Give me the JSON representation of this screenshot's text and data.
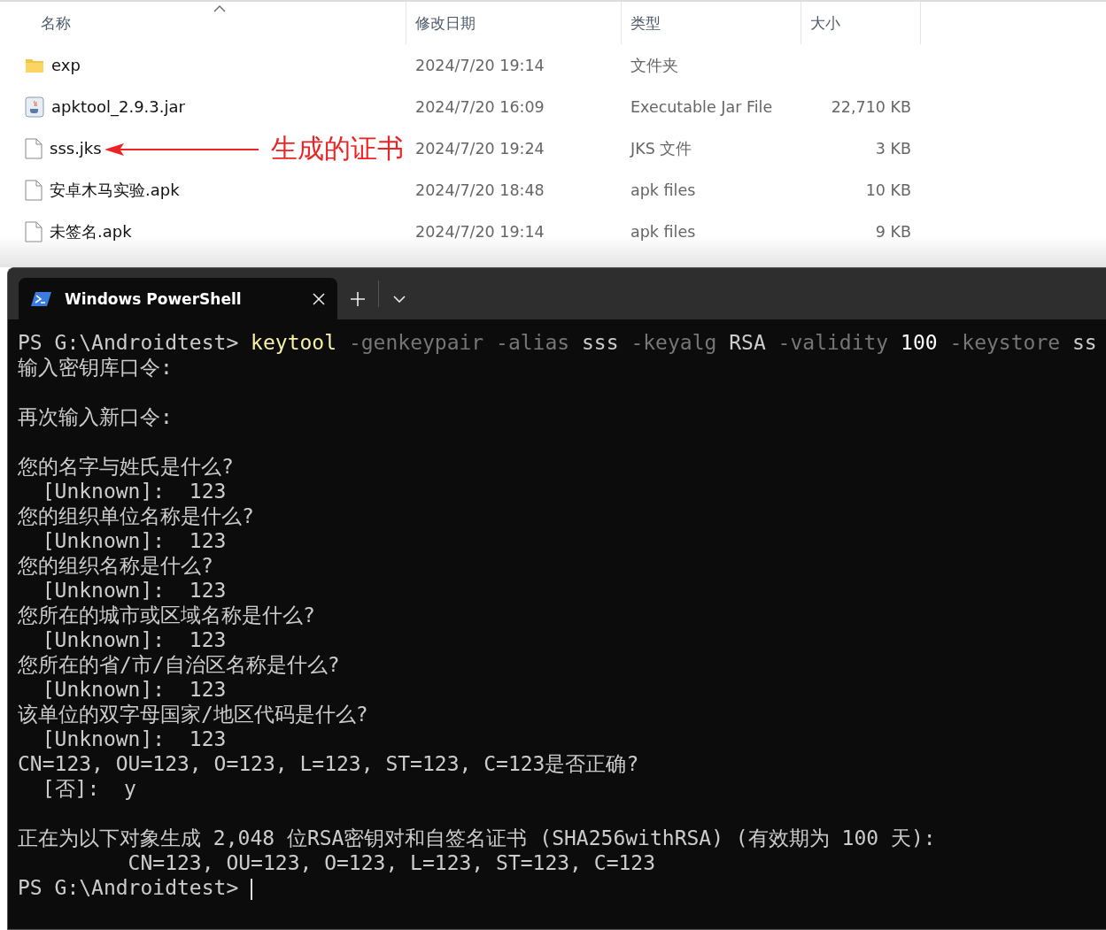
{
  "explorer": {
    "columns": [
      {
        "label": "名称",
        "sorted": true
      },
      {
        "label": "修改日期",
        "sorted": false
      },
      {
        "label": "类型",
        "sorted": false
      },
      {
        "label": "大小",
        "sorted": false
      }
    ],
    "rows": [
      {
        "kind": "folder",
        "name": "exp",
        "modified": "2024/7/20 19:14",
        "type": "文件夹"
      },
      {
        "kind": "jar",
        "name": "apktool_2.9.3.jar",
        "modified": "2024/7/20 16:09",
        "type": "Executable Jar File",
        "size": "22,710 KB"
      },
      {
        "kind": "file",
        "name": "sss.jks",
        "modified": "2024/7/20 19:24",
        "type": "JKS 文件",
        "size": "3 KB",
        "annotation": "生成的证书"
      },
      {
        "kind": "file",
        "name": "安卓木马实验.apk",
        "modified": "2024/7/20 18:48",
        "type": "apk files",
        "size": "10 KB"
      },
      {
        "kind": "file",
        "name": "未签名.apk",
        "modified": "2024/7/20 19:14",
        "type": "apk files",
        "size": "9 KB"
      }
    ]
  },
  "terminal": {
    "tabs": [
      {
        "title": "Windows PowerShell",
        "selected": true
      }
    ],
    "lines": [
      {
        "segments": [
          {
            "kind": "prompt",
            "text": "PS G:\\Androidtest> "
          },
          {
            "kind": "command",
            "text": "keytool"
          },
          {
            "kind": "parameter",
            "text": " -genkeypair -alias"
          },
          {
            "kind": "plain",
            "text": " sss "
          },
          {
            "kind": "parameter",
            "text": "-keyalg"
          },
          {
            "kind": "plain",
            "text": " RSA "
          },
          {
            "kind": "parameter",
            "text": "-validity"
          },
          {
            "kind": "number",
            "text": " 100 "
          },
          {
            "kind": "parameter",
            "text": "-keystore"
          },
          {
            "kind": "plain",
            "text": " ss"
          }
        ]
      },
      {
        "segments": [
          {
            "kind": "plain",
            "text": "输入密钥库口令:"
          }
        ],
        "blank_after": true
      },
      {
        "segments": [
          {
            "kind": "plain",
            "text": "再次输入新口令:"
          }
        ],
        "blank_after": true
      },
      {
        "segments": [
          {
            "kind": "plain",
            "text": "您的名字与姓氏是什么?"
          }
        ]
      },
      {
        "segments": [
          {
            "kind": "plain",
            "text": "  [Unknown]:  123"
          }
        ]
      },
      {
        "segments": [
          {
            "kind": "plain",
            "text": "您的组织单位名称是什么?"
          }
        ]
      },
      {
        "segments": [
          {
            "kind": "plain",
            "text": "  [Unknown]:  123"
          }
        ]
      },
      {
        "segments": [
          {
            "kind": "plain",
            "text": "您的组织名称是什么?"
          }
        ]
      },
      {
        "segments": [
          {
            "kind": "plain",
            "text": "  [Unknown]:  123"
          }
        ]
      },
      {
        "segments": [
          {
            "kind": "plain",
            "text": "您所在的城市或区域名称是什么?"
          }
        ]
      },
      {
        "segments": [
          {
            "kind": "plain",
            "text": "  [Unknown]:  123"
          }
        ]
      },
      {
        "segments": [
          {
            "kind": "plain",
            "text": "您所在的省/市/自治区名称是什么?"
          }
        ]
      },
      {
        "segments": [
          {
            "kind": "plain",
            "text": "  [Unknown]:  123"
          }
        ]
      },
      {
        "segments": [
          {
            "kind": "plain",
            "text": "该单位的双字母国家/地区代码是什么?"
          }
        ]
      },
      {
        "segments": [
          {
            "kind": "plain",
            "text": "  [Unknown]:  123"
          }
        ]
      },
      {
        "segments": [
          {
            "kind": "plain",
            "text": "CN=123, OU=123, O=123, L=123, ST=123, C=123是否正确?"
          }
        ]
      },
      {
        "segments": [
          {
            "kind": "plain",
            "text": "  [否]:  y"
          }
        ],
        "blank_after": true
      },
      {
        "segments": [
          {
            "kind": "plain",
            "text": "正在为以下对象生成 2,048 位RSA密钥对和自签名证书 (SHA256withRSA) (有效期为 100 天):"
          }
        ]
      },
      {
        "segments": [
          {
            "kind": "plain",
            "text": "         CN=123, OU=123, O=123, L=123, ST=123, C=123"
          }
        ]
      },
      {
        "segments": [
          {
            "kind": "prompt",
            "text": "PS G:\\Androidtest> "
          }
        ],
        "cursor": true
      }
    ]
  }
}
